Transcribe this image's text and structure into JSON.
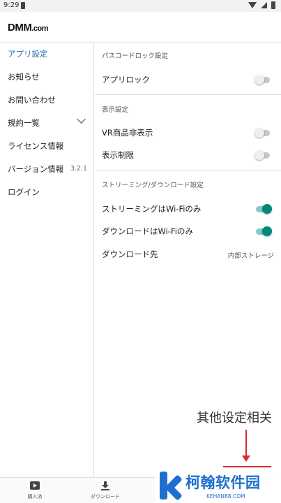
{
  "status_bar": {
    "time": "9:29"
  },
  "header": {
    "logo_main": "DMM",
    "logo_suffix": ".com"
  },
  "sidebar": {
    "items": [
      {
        "label": "アプリ設定",
        "active": true
      },
      {
        "label": "お知らせ"
      },
      {
        "label": "お問い合わせ"
      },
      {
        "label": "規約一覧"
      },
      {
        "label": "ライセンス情報"
      },
      {
        "label": "バージョン情報",
        "value": "3.2.1"
      },
      {
        "label": "ログイン"
      }
    ]
  },
  "settings": {
    "sections": [
      {
        "title": "パスコードロック設定",
        "rows": [
          {
            "label": "アプリロック",
            "toggle": false
          }
        ]
      },
      {
        "title": "表示設定",
        "rows": [
          {
            "label": "VR商品非表示",
            "toggle": false
          },
          {
            "label": "表示制限",
            "toggle": false
          }
        ]
      },
      {
        "title": "ストリーミング/ダウンロード設定",
        "rows": [
          {
            "label": "ストリーミングはWi-Fiのみ",
            "toggle": true
          },
          {
            "label": "ダウンロードはWi-Fiのみ",
            "toggle": true
          },
          {
            "label": "ダウンロード先",
            "value": "内部ストレージ"
          }
        ]
      }
    ]
  },
  "bottom_nav": {
    "items": [
      {
        "label": "購入済",
        "icon": "play-icon"
      },
      {
        "label": "ダウンロード",
        "icon": "download-icon"
      }
    ]
  },
  "annotation": {
    "text": "其他设定相关"
  },
  "watermark": {
    "name": "柯翰软件园",
    "url": "KEHAN88.COM"
  },
  "colors": {
    "accent": "#2a6fb3",
    "toggle_on": "#00897b",
    "annotation_red": "#d32f2f",
    "watermark_blue": "#1e6fd0"
  }
}
